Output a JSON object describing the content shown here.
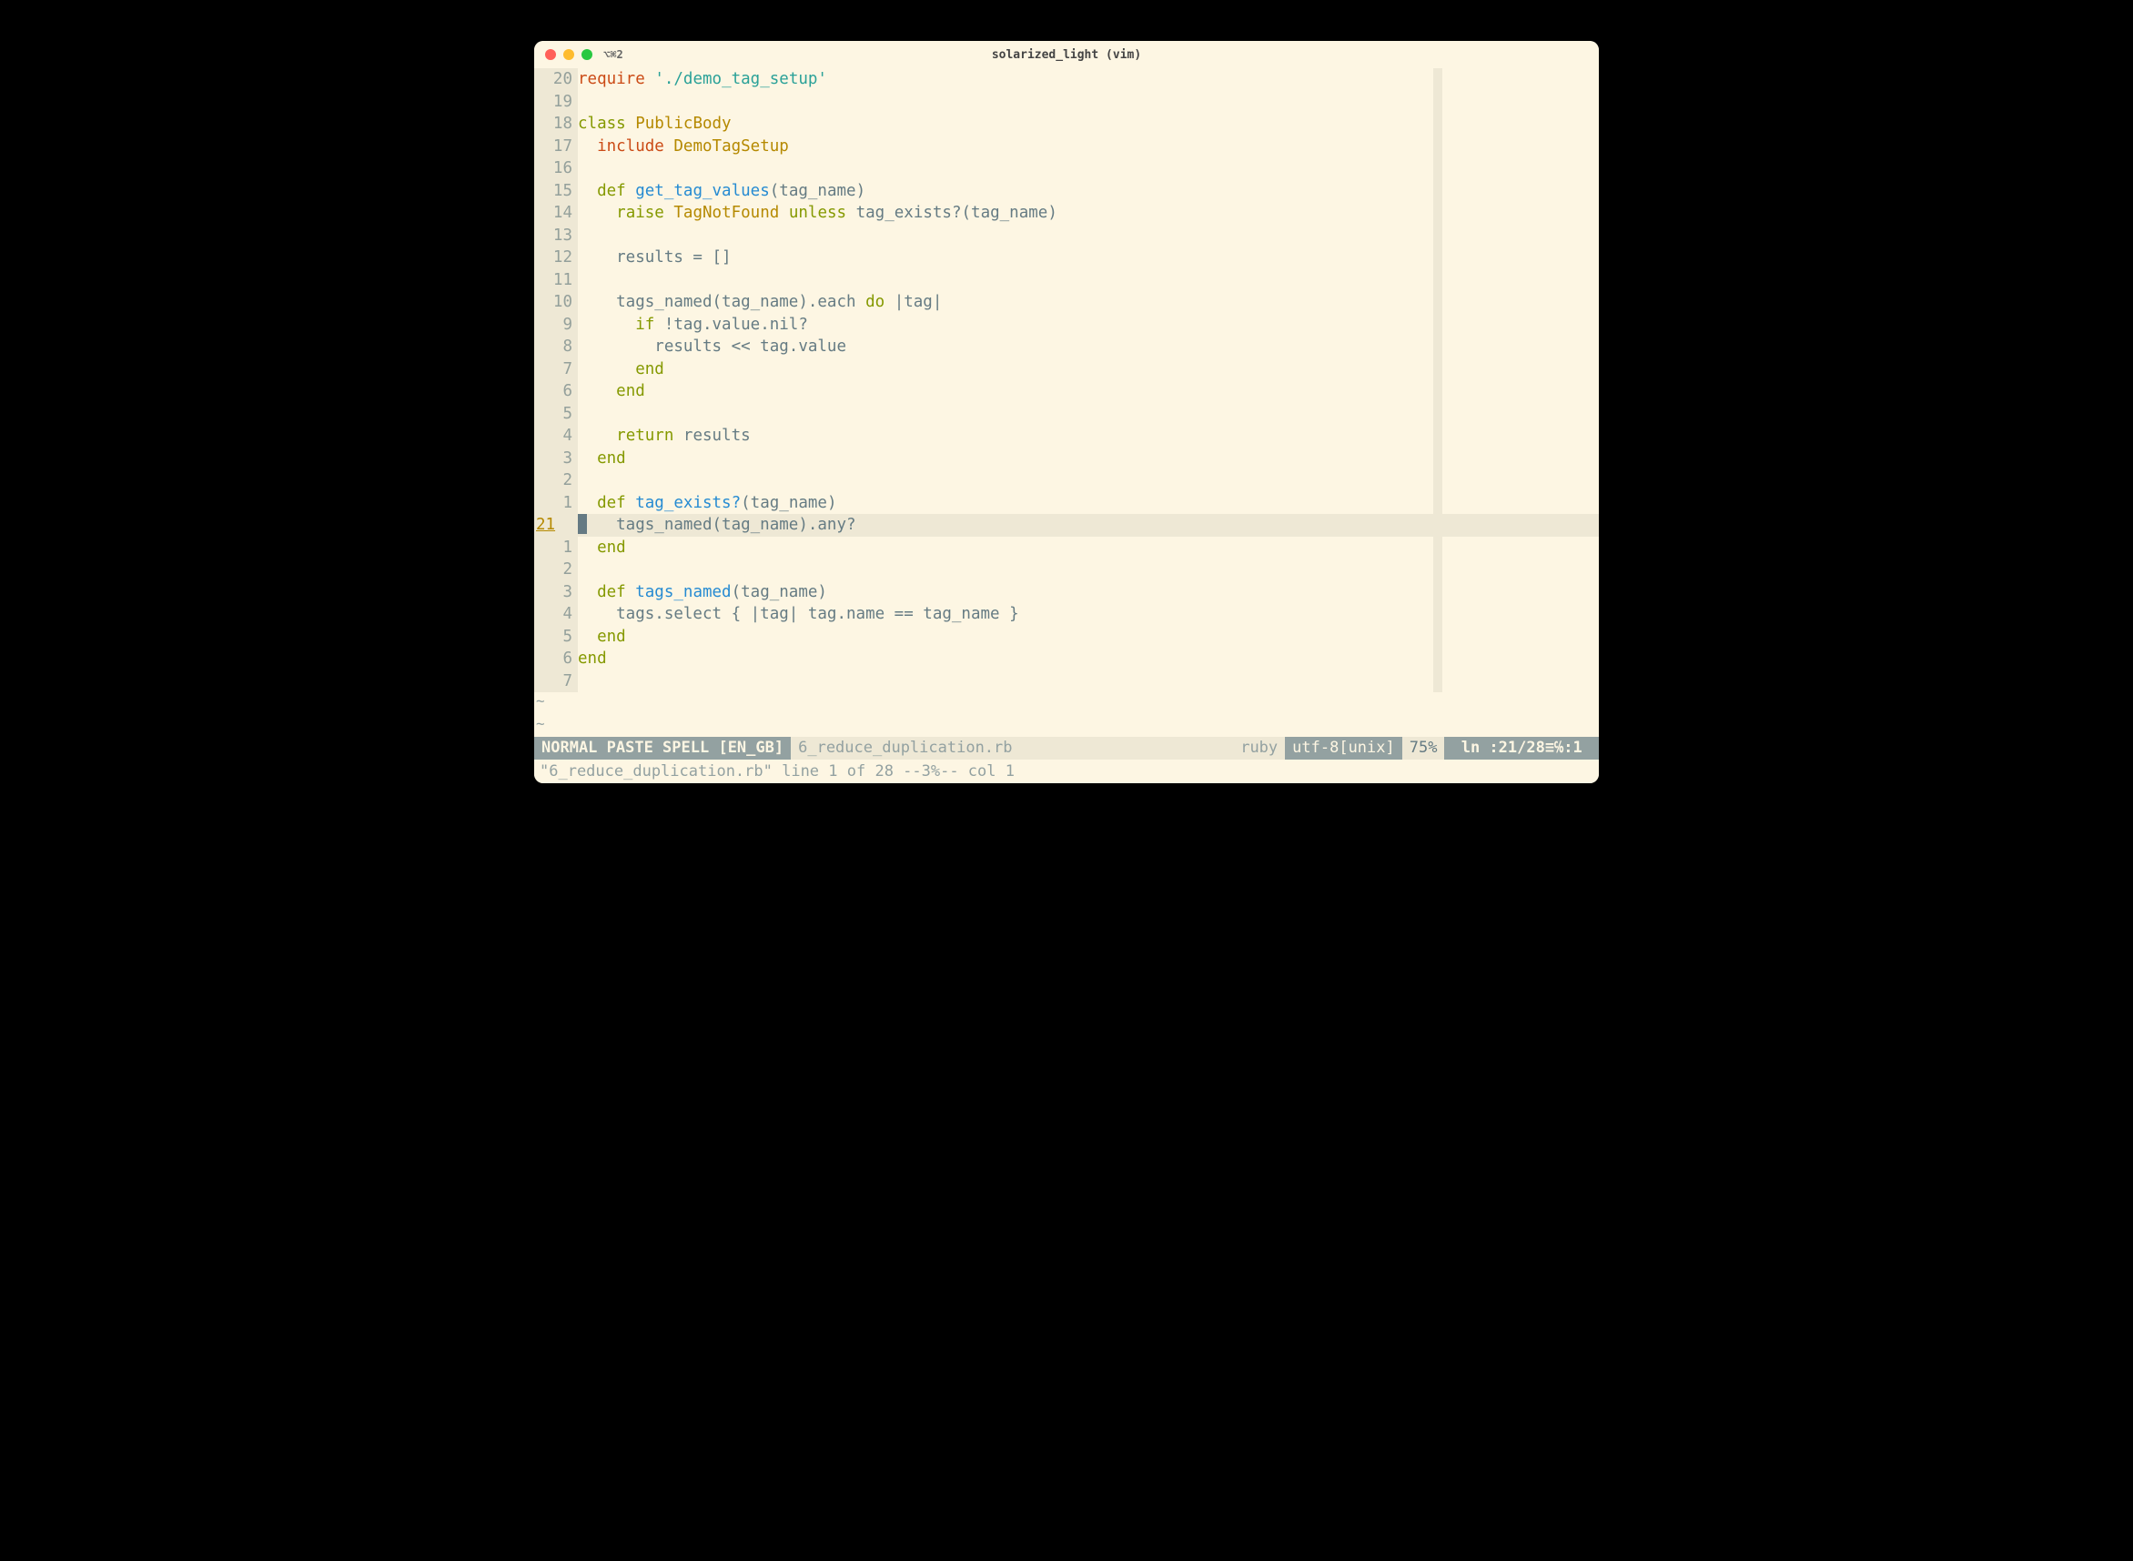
{
  "titlebar": {
    "tab_id": "⌥⌘2",
    "title": "solarized_light (vim)"
  },
  "gutter": [
    "20",
    "19",
    "18",
    "17",
    "16",
    "15",
    "14",
    "13",
    "12",
    "11",
    "10",
    " 9",
    " 8",
    " 7",
    " 6",
    " 5",
    " 4",
    " 3",
    " 2",
    " 1",
    "21",
    " 1",
    " 2",
    " 3",
    " 4",
    " 5",
    " 6",
    " 7"
  ],
  "gutter_abs_index": 20,
  "code_lines": [
    {
      "tokens": [
        {
          "t": "require",
          "c": "kw-orange"
        },
        {
          "t": " "
        },
        {
          "t": "'./demo_tag_setup'",
          "c": "str"
        }
      ]
    },
    {
      "tokens": []
    },
    {
      "tokens": [
        {
          "t": "class",
          "c": "kw-green"
        },
        {
          "t": " "
        },
        {
          "t": "PublicBody",
          "c": "const"
        }
      ]
    },
    {
      "tokens": [
        {
          "t": "  "
        },
        {
          "t": "include",
          "c": "kw-orange"
        },
        {
          "t": " "
        },
        {
          "t": "DemoTagSetup",
          "c": "const"
        }
      ]
    },
    {
      "tokens": []
    },
    {
      "tokens": [
        {
          "t": "  "
        },
        {
          "t": "def",
          "c": "kw-green"
        },
        {
          "t": " "
        },
        {
          "t": "get_tag_values",
          "c": "fn"
        },
        {
          "t": "(tag_name)"
        }
      ]
    },
    {
      "tokens": [
        {
          "t": "    "
        },
        {
          "t": "raise",
          "c": "kw-green"
        },
        {
          "t": " "
        },
        {
          "t": "TagNotFound",
          "c": "const"
        },
        {
          "t": " "
        },
        {
          "t": "unless",
          "c": "kw-green"
        },
        {
          "t": " tag_exists?(tag_name)"
        }
      ]
    },
    {
      "tokens": []
    },
    {
      "tokens": [
        {
          "t": "    results = []"
        }
      ]
    },
    {
      "tokens": []
    },
    {
      "tokens": [
        {
          "t": "    tags_named(tag_name).each "
        },
        {
          "t": "do",
          "c": "kw-green"
        },
        {
          "t": " |tag|"
        }
      ]
    },
    {
      "tokens": [
        {
          "t": "      "
        },
        {
          "t": "if",
          "c": "kw-green"
        },
        {
          "t": " !tag.value.nil?"
        }
      ]
    },
    {
      "tokens": [
        {
          "t": "        results << tag.value"
        }
      ]
    },
    {
      "tokens": [
        {
          "t": "      "
        },
        {
          "t": "end",
          "c": "kw-green"
        }
      ]
    },
    {
      "tokens": [
        {
          "t": "    "
        },
        {
          "t": "end",
          "c": "kw-green"
        }
      ]
    },
    {
      "tokens": []
    },
    {
      "tokens": [
        {
          "t": "    "
        },
        {
          "t": "return",
          "c": "kw-green"
        },
        {
          "t": " results"
        }
      ]
    },
    {
      "tokens": [
        {
          "t": "  "
        },
        {
          "t": "end",
          "c": "kw-green"
        }
      ]
    },
    {
      "tokens": []
    },
    {
      "tokens": [
        {
          "t": "  "
        },
        {
          "t": "def",
          "c": "kw-green"
        },
        {
          "t": " "
        },
        {
          "t": "tag_exists?",
          "c": "fn"
        },
        {
          "t": "(tag_name)"
        }
      ]
    },
    {
      "cursor": true,
      "tokens": [
        {
          "t": "    tags_named(tag_name).any?"
        }
      ]
    },
    {
      "tokens": [
        {
          "t": "  "
        },
        {
          "t": "end",
          "c": "kw-green"
        }
      ]
    },
    {
      "tokens": []
    },
    {
      "tokens": [
        {
          "t": "  "
        },
        {
          "t": "def",
          "c": "kw-green"
        },
        {
          "t": " "
        },
        {
          "t": "tags_named",
          "c": "fn"
        },
        {
          "t": "(tag_name)"
        }
      ]
    },
    {
      "tokens": [
        {
          "t": "    tags.select { |tag| tag.name == tag_name }"
        }
      ]
    },
    {
      "tokens": [
        {
          "t": "  "
        },
        {
          "t": "end",
          "c": "kw-green"
        }
      ]
    },
    {
      "tokens": [
        {
          "t": "end",
          "c": "kw-green"
        }
      ]
    },
    {
      "tokens": []
    }
  ],
  "tilde_count": 2,
  "statusline": {
    "mode": " NORMAL  PASTE  SPELL [EN_GB] ",
    "filename": "6_reduce_duplication.rb",
    "filetype": "ruby ",
    "encoding": " utf-8[unix] ",
    "percent": " 75% ",
    "position": " ln :21/28≡℅:1 "
  },
  "cmdline": "\"6_reduce_duplication.rb\" line 1 of 28 --3%-- col 1"
}
